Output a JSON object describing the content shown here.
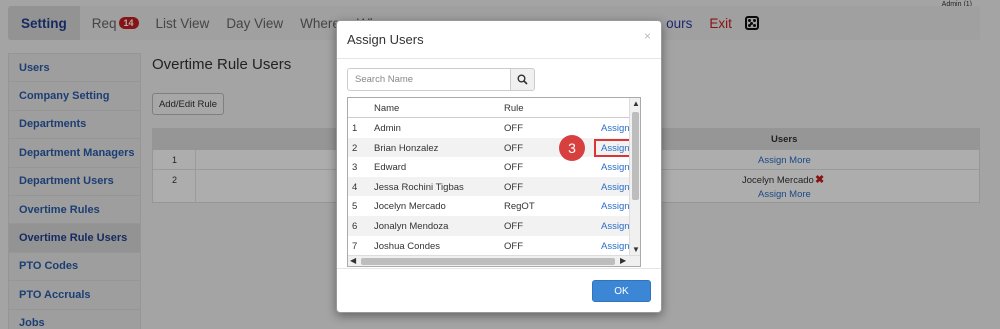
{
  "header": {
    "admin_label": "Admin (1)",
    "tabs": [
      {
        "label": "Setting",
        "active": true
      },
      {
        "label": "Req",
        "badge": "14"
      },
      {
        "label": "List View"
      },
      {
        "label": "Day View"
      },
      {
        "label": "Where"
      },
      {
        "label": "Wh"
      },
      {
        "label": "ours",
        "color": "blue"
      },
      {
        "label": "Exit",
        "color": "red"
      }
    ],
    "dice_icon": "dice-icon"
  },
  "sidebar": {
    "items": [
      {
        "label": "Users"
      },
      {
        "label": "Company Setting"
      },
      {
        "label": "Departments"
      },
      {
        "label": "Department Managers"
      },
      {
        "label": "Department Users"
      },
      {
        "label": "Overtime Rules"
      },
      {
        "label": "Overtime Rule Users",
        "selected": true
      },
      {
        "label": "PTO Codes"
      },
      {
        "label": "PTO Accruals"
      },
      {
        "label": "Jobs"
      }
    ]
  },
  "main": {
    "title": "Overtime Rule Users",
    "add_edit_button": "Add/Edit Rule",
    "table": {
      "users_header": "Users",
      "rows": [
        {
          "num": "1",
          "assign_link": "Assign More"
        },
        {
          "num": "2",
          "user": "Jocelyn Mercado",
          "assign_link": "Assign More"
        }
      ]
    }
  },
  "modal": {
    "title": "Assign Users",
    "close": "×",
    "search_placeholder": "Search Name",
    "columns": {
      "name": "Name",
      "rule": "Rule"
    },
    "rows": [
      {
        "num": "1",
        "name": "Admin",
        "rule": "OFF",
        "action": "Assign"
      },
      {
        "num": "2",
        "name": "Brian Honzalez",
        "rule": "OFF",
        "action": "Assign",
        "highlighted": true
      },
      {
        "num": "3",
        "name": "Edward",
        "rule": "OFF",
        "action": "Assign"
      },
      {
        "num": "4",
        "name": "Jessa Rochini Tigbas",
        "rule": "OFF",
        "action": "Assign"
      },
      {
        "num": "5",
        "name": "Jocelyn Mercado",
        "rule": "RegOT",
        "action": "Assign"
      },
      {
        "num": "6",
        "name": "Jonalyn Mendoza",
        "rule": "OFF",
        "action": "Assign"
      },
      {
        "num": "7",
        "name": "Joshua Condes",
        "rule": "OFF",
        "action": "Assign"
      }
    ],
    "step_marker": "3",
    "ok_button": "OK"
  },
  "colors": {
    "accent": "#3b87d6",
    "danger": "#c81e1e",
    "link": "#2a6ec6"
  }
}
